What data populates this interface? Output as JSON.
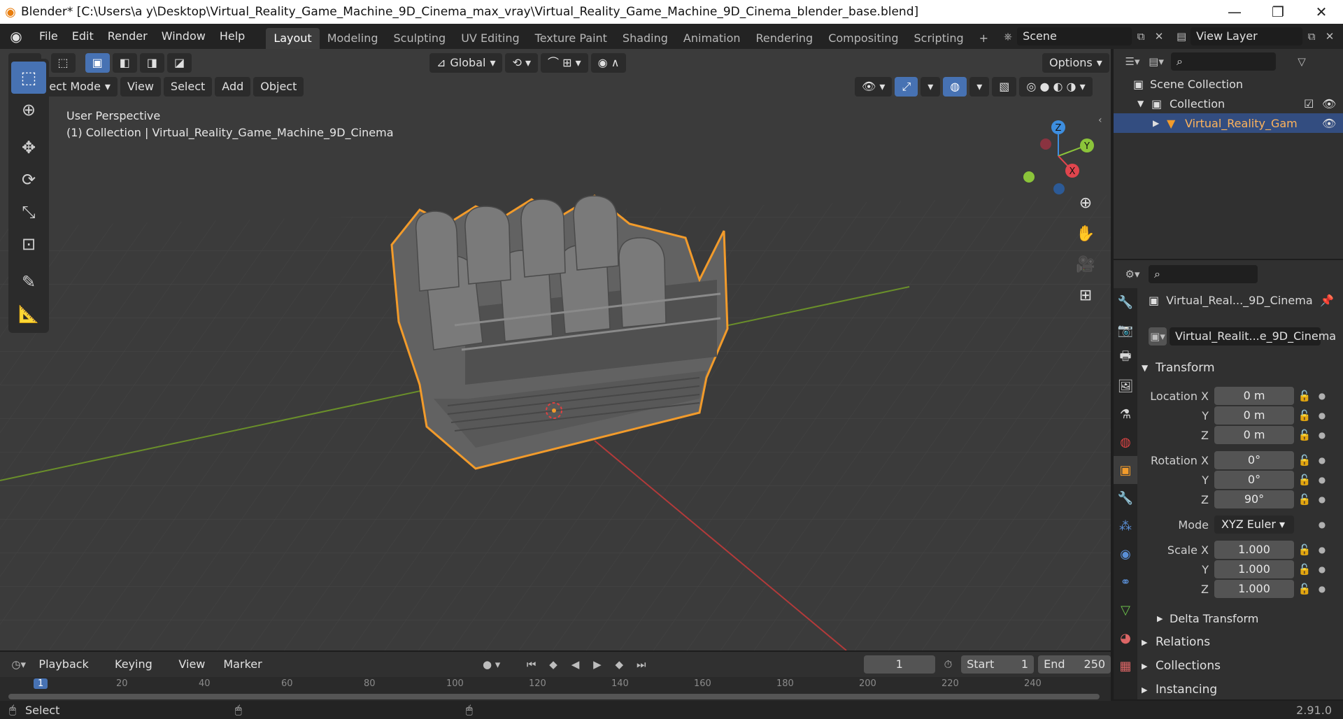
{
  "window": {
    "title": "Blender* [C:\\Users\\a y\\Desktop\\Virtual_Reality_Game_Machine_9D_Cinema_max_vray\\Virtual_Reality_Game_Machine_9D_Cinema_blender_base.blend]",
    "minimize": "—",
    "maximize": "❐",
    "close": "✕"
  },
  "menu": [
    "File",
    "Edit",
    "Render",
    "Window",
    "Help"
  ],
  "workspaces": [
    "Layout",
    "Modeling",
    "Sculpting",
    "UV Editing",
    "Texture Paint",
    "Shading",
    "Animation",
    "Rendering",
    "Compositing",
    "Scripting"
  ],
  "active_workspace": "Layout",
  "scene": {
    "name": "Scene",
    "view_layer": "View Layer"
  },
  "viewport": {
    "orientation": "Global",
    "options_label": "Options",
    "mode": "Object Mode",
    "header_menus": [
      "View",
      "Select",
      "Add",
      "Object"
    ],
    "perspective_label": "User Perspective",
    "collection_label": "(1) Collection | Virtual_Reality_Game_Machine_9D_Cinema",
    "gizmo": {
      "z": "Z",
      "y": "Y",
      "x": "X"
    }
  },
  "outliner": {
    "scene_collection": "Scene Collection",
    "collection": "Collection",
    "object": "Virtual_Reality_Gam"
  },
  "properties": {
    "object_name": "Virtual_Real..._9D_Cinema",
    "mesh_name": "Virtual_Realit...e_9D_Cinema",
    "transform_title": "Transform",
    "location": {
      "label": "Location X",
      "x": "0 m",
      "y": "0 m",
      "z": "0 m"
    },
    "rotation": {
      "label": "Rotation X",
      "x": "0°",
      "y": "0°",
      "z": "90°"
    },
    "mode_label": "Mode",
    "mode_value": "XYZ Euler",
    "scale": {
      "label": "Scale X",
      "x": "1.000",
      "y": "1.000",
      "z": "1.000"
    },
    "axis_y": "Y",
    "axis_z": "Z",
    "delta": "Delta Transform",
    "sections": [
      "Relations",
      "Collections",
      "Instancing"
    ]
  },
  "timeline": {
    "menus": [
      "Playback",
      "Keying",
      "View",
      "Marker"
    ],
    "current_frame": "1",
    "start_label": "Start",
    "start": "1",
    "end_label": "End",
    "end": "250",
    "ticks": [
      "1",
      "20",
      "40",
      "60",
      "80",
      "100",
      "120",
      "140",
      "160",
      "180",
      "200",
      "220",
      "240"
    ]
  },
  "status": {
    "left": "Select",
    "version": "2.91.0"
  },
  "colors": {
    "selection": "#4772b3",
    "outline": "#f29b2b",
    "x_axis": "#e0454d",
    "y_axis": "#8bc43a",
    "z_axis": "#3d8ee0"
  }
}
